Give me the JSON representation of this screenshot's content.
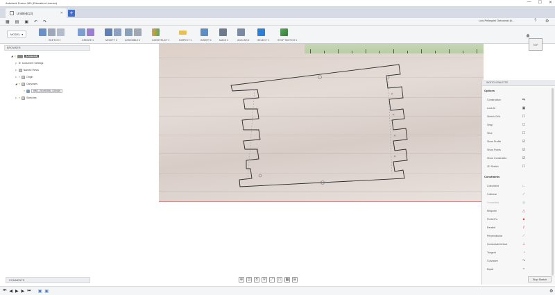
{
  "window": {
    "title": "Autodesk Fusion 360 (Education License)",
    "controls": [
      "—",
      "☐",
      "✕"
    ]
  },
  "tab": {
    "label": "Untitled(13)",
    "close": "✕",
    "new": "+"
  },
  "quick_access": {
    "user_name": "Luis Pellegrini Ostrowski (b...",
    "icons": [
      "grid-icon",
      "file-icon",
      "save-icon",
      "undo-icon",
      "redo-icon"
    ]
  },
  "workspace": {
    "label": "MODEL",
    "arrow": "▾"
  },
  "ribbon": {
    "groups": [
      {
        "label": "SKETCH ▾"
      },
      {
        "label": "CREATE ▾"
      },
      {
        "label": "MODIFY ▾"
      },
      {
        "label": "ASSEMBLE ▾"
      },
      {
        "label": "CONSTRUCT ▾"
      },
      {
        "label": "INSPECT ▾"
      },
      {
        "label": "INSERT ▾"
      },
      {
        "label": "MAKE ▾"
      },
      {
        "label": "ADD-INS ▾"
      },
      {
        "label": "SELECT ▾"
      },
      {
        "label": "STOP SKETCH ▾"
      }
    ]
  },
  "browser": {
    "header": "BROWSER",
    "items": [
      {
        "label": "(Unsaved)"
      },
      {
        "label": "Document Settings"
      },
      {
        "label": "Named Views"
      },
      {
        "label": "Origin"
      },
      {
        "label": "Canvases"
      },
      {
        "label": "IMG_20190306_130440"
      },
      {
        "label": "Sketches"
      }
    ]
  },
  "viewcube": {
    "face_label": "TOP"
  },
  "sketch_palette": {
    "header": "SKETCH PALETTE",
    "options_title": "Options",
    "options": [
      {
        "label": "Construction",
        "icon": "construction-icon"
      },
      {
        "label": "Look At",
        "icon": "look-at-icon"
      },
      {
        "label": "Sketch Grid",
        "icon": "sketch-grid-icon"
      },
      {
        "label": "Snap",
        "icon": "snap-icon"
      },
      {
        "label": "Slice",
        "icon": "slice-icon"
      },
      {
        "label": "Show Profile",
        "icon": "show-profile-icon"
      },
      {
        "label": "Show Points",
        "icon": "show-points-icon"
      },
      {
        "label": "Show Constraints",
        "icon": "show-constraints-icon"
      },
      {
        "label": "3D Sketch",
        "icon": "3d-sketch-icon"
      }
    ],
    "constraints_title": "Constraints",
    "constraints": [
      {
        "label": "Coincident",
        "icon": "coincident-icon",
        "color": "#8a8a8a"
      },
      {
        "label": "Collinear",
        "icon": "collinear-icon",
        "color": "#8a8a8a"
      },
      {
        "label": "Concentric",
        "icon": "concentric-icon",
        "color": "#b0b0b0"
      },
      {
        "label": "Midpoint",
        "icon": "midpoint-icon",
        "color": "#d04040"
      },
      {
        "label": "Fix/UnFix",
        "icon": "fix-icon",
        "color": "#d04040"
      },
      {
        "label": "Parallel",
        "icon": "parallel-icon",
        "color": "#d04040"
      },
      {
        "label": "Perpendicular",
        "icon": "perpendicular-icon",
        "color": "#8a8a8a"
      },
      {
        "label": "Horizontal/Vertical",
        "icon": "horizontal-vertical-icon",
        "color": "#d04040"
      },
      {
        "label": "Tangent",
        "icon": "tangent-icon",
        "color": "#d04040"
      },
      {
        "label": "Curvature",
        "icon": "curvature-icon",
        "color": "#d04040"
      },
      {
        "label": "Equal",
        "icon": "equal-icon",
        "color": "#8a8a8a"
      }
    ],
    "stop_button": "Stop Sketch"
  },
  "comments": {
    "label": "COMMENTS"
  },
  "timeline": {
    "buttons": [
      "⏮",
      "◀",
      "▶",
      "▶",
      "⏭"
    ]
  }
}
